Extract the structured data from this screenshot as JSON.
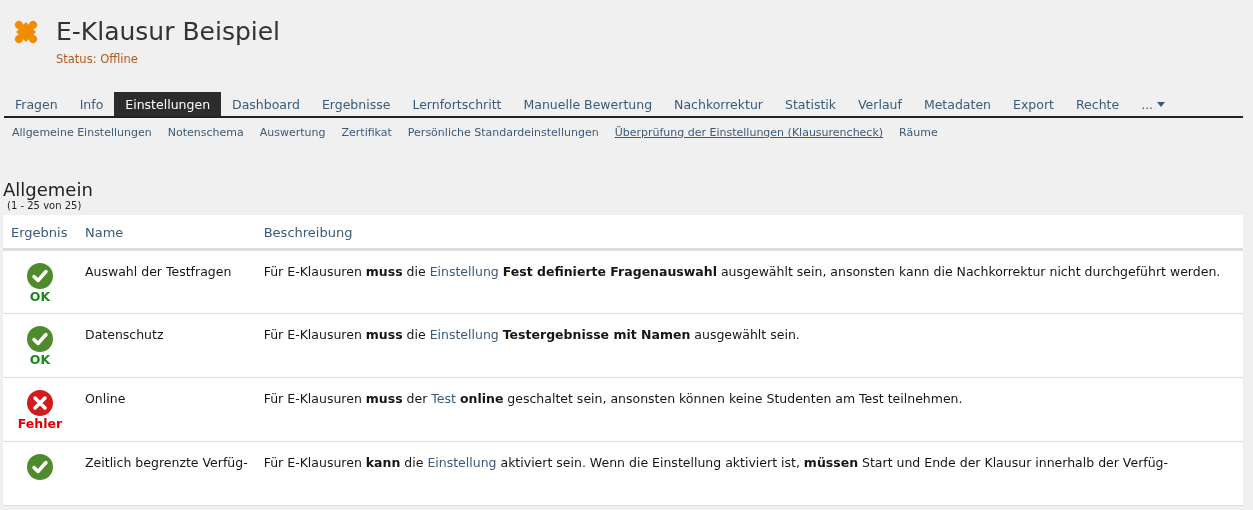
{
  "header": {
    "title": "E-Klausur Beispiel",
    "status": "Status: Offline"
  },
  "tabs": [
    {
      "label": "Fragen",
      "selected": false
    },
    {
      "label": "Info",
      "selected": false
    },
    {
      "label": "Einstellungen",
      "selected": true
    },
    {
      "label": "Dashboard",
      "selected": false
    },
    {
      "label": "Ergebnisse",
      "selected": false
    },
    {
      "label": "Lernfortschritt",
      "selected": false
    },
    {
      "label": "Manuelle Bewertung",
      "selected": false
    },
    {
      "label": "Nachkorrektur",
      "selected": false
    },
    {
      "label": "Statistik",
      "selected": false
    },
    {
      "label": "Verlauf",
      "selected": false
    },
    {
      "label": "Metadaten",
      "selected": false
    },
    {
      "label": "Export",
      "selected": false
    },
    {
      "label": "Rechte",
      "selected": false
    },
    {
      "label": "...",
      "selected": false
    }
  ],
  "subtabs": [
    {
      "label": "Allgemeine Einstellungen",
      "selected": false
    },
    {
      "label": "Notenschema",
      "selected": false
    },
    {
      "label": "Auswertung",
      "selected": false
    },
    {
      "label": "Zertifikat",
      "selected": false
    },
    {
      "label": "Persönliche Standardeinstellungen",
      "selected": false
    },
    {
      "label": "Überprüfung der Einstellungen (Klausurencheck)",
      "selected": true
    },
    {
      "label": "Räume",
      "selected": false
    }
  ],
  "section": {
    "title": "Allgemein",
    "range": "(1 - 25 von 25)"
  },
  "table": {
    "columns": [
      "Ergebnis",
      "Name",
      "Beschreibung"
    ],
    "rows": [
      {
        "result": {
          "kind": "ok",
          "label": "OK"
        },
        "name": "Auswahl der Testfragen",
        "description": [
          {
            "kind": "text",
            "text": "Für E-Klausuren **muss** die "
          },
          {
            "kind": "link",
            "text": "Einstellung"
          },
          {
            "kind": "text",
            "text": " **Fest definierte Fragenauswahl** ausgewählt sein, ansonsten kann die Nachkorrektur nicht durchgeführt werden."
          }
        ]
      },
      {
        "result": {
          "kind": "ok",
          "label": "OK"
        },
        "name": "Datenschutz",
        "description": [
          {
            "kind": "text",
            "text": "Für E-Klausuren **muss** die "
          },
          {
            "kind": "link",
            "text": "Einstellung"
          },
          {
            "kind": "text",
            "text": " **Testergebnisse mit Namen** ausgewählt sein."
          }
        ]
      },
      {
        "result": {
          "kind": "error",
          "label": "Fehler"
        },
        "name": "Online",
        "description": [
          {
            "kind": "text",
            "text": "Für E-Klausuren **muss** der "
          },
          {
            "kind": "link",
            "text": "Test"
          },
          {
            "kind": "text",
            "text": " **online** geschaltet sein, ansonsten können keine Studenten am Test teilnehmen."
          }
        ]
      },
      {
        "result": {
          "kind": "ok"
        },
        "name": "Zeitlich begrenzte Verfüg-",
        "description": [
          {
            "kind": "text",
            "text": "Für E-Klausuren **kann** die "
          },
          {
            "kind": "link",
            "text": "Einstellung"
          },
          {
            "kind": "text",
            "text": " aktiviert sein. Wenn die Einstellung aktiviert ist, **müssen** Start und Ende der Klausur innerhalb der Verfüg-"
          }
        ]
      }
    ]
  }
}
